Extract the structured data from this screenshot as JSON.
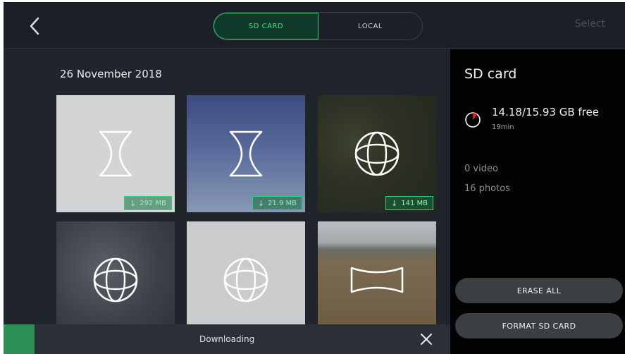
{
  "topbar": {
    "tabs": [
      {
        "label": "SD CARD",
        "active": true
      },
      {
        "label": "LOCAL",
        "active": false
      }
    ],
    "select_label": "Select"
  },
  "gallery": {
    "date": "26 November 2018",
    "thumbnails": [
      {
        "icon": "hourglass-lens-icon",
        "badge": "292 MB",
        "has_badge": true
      },
      {
        "icon": "hourglass-lens-icon",
        "badge": "21.9 MB",
        "has_badge": true
      },
      {
        "icon": "sphere-globe-icon",
        "badge": "141 MB",
        "has_badge": true
      },
      {
        "icon": "sphere-globe-icon",
        "has_badge": false
      },
      {
        "icon": "sphere-globe-icon",
        "has_badge": false
      },
      {
        "icon": "panorama-icon",
        "has_badge": false
      }
    ]
  },
  "panel": {
    "title": "SD card",
    "storage_free": "14.18/15.93 GB free",
    "storage_time": "19min",
    "used_fraction": 0.11,
    "videos": "0 video",
    "photos": "16 photos",
    "erase_label": "ERASE ALL",
    "format_label": "FORMAT SD CARD"
  },
  "download": {
    "label": "Downloading",
    "progress_fraction": 0.07
  },
  "colors": {
    "accent_green": "#2fd27a",
    "background": "#20252b",
    "panel_bg": "#030303",
    "storage_used_red": "#e01e1e"
  }
}
